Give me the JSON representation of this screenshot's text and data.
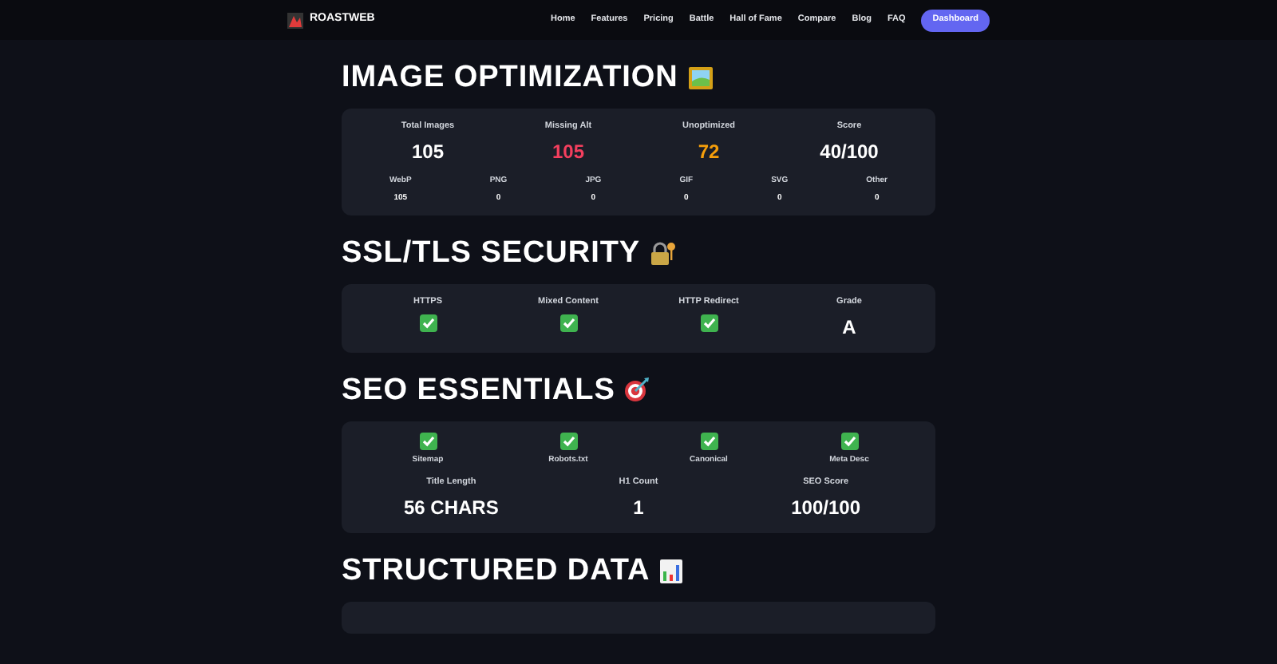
{
  "nav": {
    "brand": "ROASTWEB",
    "links": [
      "Home",
      "Features",
      "Pricing",
      "Battle",
      "Hall of Fame",
      "Compare",
      "Blog",
      "FAQ"
    ],
    "button": "Dashboard"
  },
  "sections": [
    {
      "title": "IMAGE OPTIMIZATION",
      "rows": [
        {
          "kind": "stats",
          "items": [
            {
              "label": "Total Images",
              "value": "105",
              "color": "#ffffff"
            },
            {
              "label": "Missing Alt",
              "value": "105",
              "color": "#f43f5e"
            },
            {
              "label": "Unoptimized",
              "value": "72",
              "color": "#f59e0b"
            },
            {
              "label": "Score",
              "value": "40/100",
              "color": "#ffffff"
            }
          ]
        },
        {
          "kind": "small",
          "items": [
            {
              "label": "WebP",
              "value": "105"
            },
            {
              "label": "PNG",
              "value": "0"
            },
            {
              "label": "JPG",
              "value": "0"
            },
            {
              "label": "GIF",
              "value": "0"
            },
            {
              "label": "SVG",
              "value": "0"
            },
            {
              "label": "Other",
              "value": "0"
            }
          ]
        }
      ]
    },
    {
      "title": "SSL/TLS SECURITY",
      "rows": [
        {
          "kind": "checks_below",
          "items": [
            {
              "label": "HTTPS",
              "checked": true
            },
            {
              "label": "Mixed Content",
              "checked": true
            },
            {
              "label": "HTTP Redirect",
              "checked": true
            }
          ],
          "extra": {
            "label": "Grade",
            "value": "A"
          }
        }
      ]
    },
    {
      "title": "SEO ESSENTIALS",
      "rows": [
        {
          "kind": "checks_above",
          "items": [
            {
              "label": "Sitemap",
              "checked": true
            },
            {
              "label": "Robots.txt",
              "checked": true
            },
            {
              "label": "Canonical",
              "checked": true
            },
            {
              "label": "Meta Desc",
              "checked": true
            }
          ]
        },
        {
          "kind": "stats",
          "items": [
            {
              "label": "Title Length",
              "value": "56 CHARS"
            },
            {
              "label": "H1 Count",
              "value": "1"
            },
            {
              "label": "SEO Score",
              "value": "100/100"
            }
          ]
        }
      ]
    },
    {
      "title": "STRUCTURED DATA"
    }
  ]
}
